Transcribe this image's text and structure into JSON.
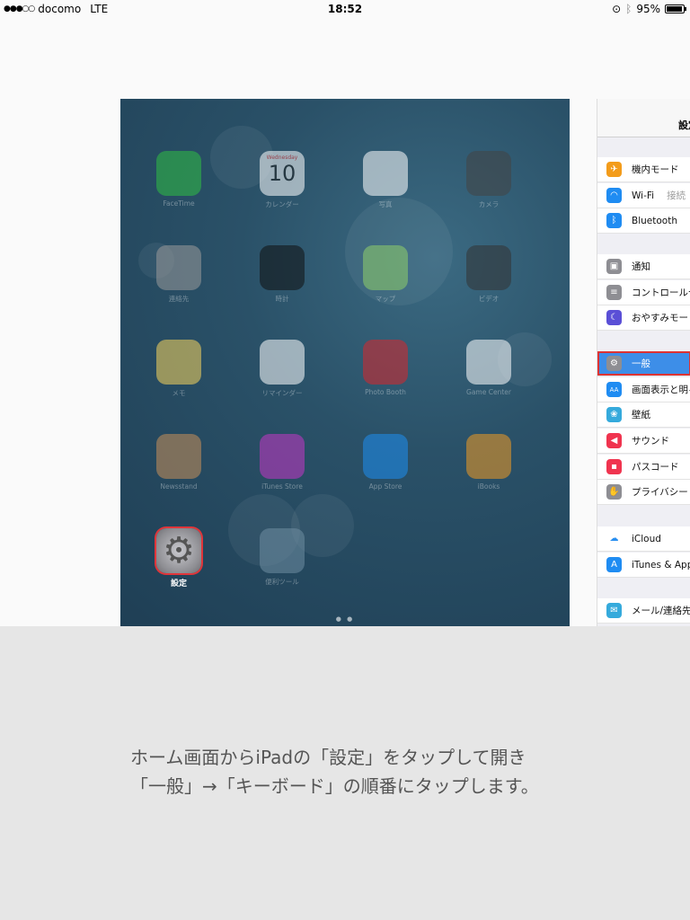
{
  "status_bar": {
    "signal_dots": "●●●○○",
    "carrier": "docomo",
    "network": "LTE",
    "time": "18:52",
    "battery": "95%",
    "battery_level": 0.95
  },
  "home_screen": {
    "apps": [
      {
        "label": "FaceTime",
        "icon": "facetime-icon",
        "color": "#2fbf44"
      },
      {
        "label": "カレンダー",
        "icon": "calendar-icon",
        "color": "#ffffff",
        "day": "Wednesday",
        "date": "10"
      },
      {
        "label": "写真",
        "icon": "photos-icon",
        "color": "#ffffff"
      },
      {
        "label": "カメラ",
        "icon": "camera-icon",
        "color": "#444444"
      },
      {
        "label": "連絡先",
        "icon": "contacts-icon",
        "color": "#9b9b9b"
      },
      {
        "label": "時計",
        "icon": "clock-icon",
        "color": "#111111"
      },
      {
        "label": "マップ",
        "icon": "maps-icon",
        "color": "#8fcf6a"
      },
      {
        "label": "ビデオ",
        "icon": "videos-icon",
        "color": "#333333"
      },
      {
        "label": "メモ",
        "icon": "notes-icon",
        "color": "#f7d55c"
      },
      {
        "label": "リマインダー",
        "icon": "reminders-icon",
        "color": "#ffffff"
      },
      {
        "label": "Photo Booth",
        "icon": "photo-booth-icon",
        "color": "#d8262c"
      },
      {
        "label": "Game Center",
        "icon": "game-center-icon",
        "color": "#ffffff"
      },
      {
        "label": "Newsstand",
        "icon": "newsstand-icon",
        "color": "#c98f5a"
      },
      {
        "label": "iTunes Store",
        "icon": "itunes-store-icon",
        "color": "#c536c7"
      },
      {
        "label": "App Store",
        "icon": "app-store-icon",
        "color": "#1e8ef0"
      },
      {
        "label": "iBooks",
        "icon": "ibooks-icon",
        "color": "#f09a22"
      },
      {
        "label": "設定",
        "icon": "settings-gear-icon",
        "color": "#8e8e93"
      },
      {
        "label": "便利ツール",
        "icon": "folder-icon",
        "color": "#6f8ea3"
      }
    ],
    "page_dots": "● ●"
  },
  "settings_panel": {
    "title": "設定",
    "rows": [
      {
        "label": "機内モード",
        "icon": "airplane-icon",
        "color": "#f39c1b",
        "glyph": "✈"
      },
      {
        "label": "Wi-Fi",
        "icon": "wifi-icon",
        "color": "#1f8cf2",
        "glyph": "◠",
        "value": "接続"
      },
      {
        "label": "Bluetooth",
        "icon": "bluetooth-icon",
        "color": "#1f8cf2",
        "glyph": "ᛒ"
      },
      {
        "label": "通知",
        "icon": "notifications-icon",
        "color": "#8e8e93",
        "glyph": "▣"
      },
      {
        "label": "コントロールセンター",
        "icon": "control-center-icon",
        "color": "#8e8e93",
        "glyph": "≡"
      },
      {
        "label": "おやすみモード",
        "icon": "moon-icon",
        "color": "#5a4fd6",
        "glyph": "☾"
      },
      {
        "label": "一般",
        "icon": "gear-icon",
        "color": "#8e8e93",
        "glyph": "⚙"
      },
      {
        "label": "画面表示と明るさ",
        "icon": "display-icon",
        "color": "#1f8cf2",
        "glyph": "AA"
      },
      {
        "label": "壁紙",
        "icon": "wallpaper-icon",
        "color": "#35aadc",
        "glyph": "❀"
      },
      {
        "label": "サウンド",
        "icon": "sound-icon",
        "color": "#f0344f",
        "glyph": "◀"
      },
      {
        "label": "パスコード",
        "icon": "lock-icon",
        "color": "#f0344f",
        "glyph": "▪"
      },
      {
        "label": "プライバシー",
        "icon": "hand-icon",
        "color": "#8e8e93",
        "glyph": "✋"
      },
      {
        "label": "iCloud",
        "icon": "icloud-icon",
        "color": "#ffffff",
        "glyph": "☁"
      },
      {
        "label": "iTunes & App Store",
        "icon": "app-store-small-icon",
        "color": "#1f8cf2",
        "glyph": "A"
      },
      {
        "label": "メール/連絡先/カレンダー",
        "icon": "mail-icon",
        "color": "#35aadc",
        "glyph": "✉"
      }
    ],
    "selected": "一般"
  },
  "caption": {
    "line1": "ホーム画面からiPadの「設定」をタップして開き",
    "line2": "「一般」→「キーボード」の順番にタップします。"
  }
}
